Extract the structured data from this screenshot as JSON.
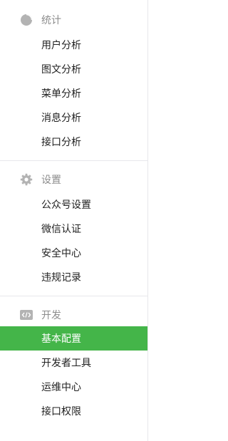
{
  "sections": [
    {
      "title": "统计",
      "icon": "pie-chart-icon",
      "items": [
        "用户分析",
        "图文分析",
        "菜单分析",
        "消息分析",
        "接口分析"
      ]
    },
    {
      "title": "设置",
      "icon": "gear-icon",
      "items": [
        "公众号设置",
        "微信认证",
        "安全中心",
        "违规记录"
      ]
    },
    {
      "title": "开发",
      "icon": "code-icon",
      "items": [
        "基本配置",
        "开发者工具",
        "运维中心",
        "接口权限"
      ],
      "active_item": "基本配置"
    }
  ],
  "colors": {
    "active_bg": "#44b549",
    "icon_gray": "#b3b3b3",
    "header_text": "#8d8d8d",
    "divider": "#e7e7eb"
  }
}
